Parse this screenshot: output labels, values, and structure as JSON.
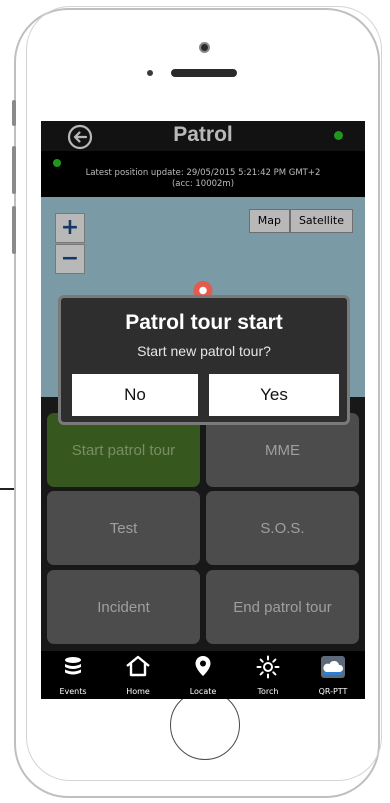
{
  "app": {
    "title": "Patrol"
  },
  "header": {
    "back_icon": "back-arrow-icon",
    "status_dot_color": "#2bd12b"
  },
  "position_status": {
    "line1": "Latest position update: 29/05/2015 5:21:42 PM GMT+2",
    "line2": "(acc: 10002m)"
  },
  "map": {
    "zoom_in": "+",
    "zoom_out": "−",
    "type_buttons": [
      "Map",
      "Satellite"
    ],
    "water_color": "#aad6e6",
    "marker_icon": "map-pin-icon"
  },
  "actions": {
    "tiles": [
      "Start patrol tour",
      "MME",
      "Test",
      "S.O.S.",
      "Incident",
      "End patrol tour"
    ],
    "highlight_color": "#4c7a2c"
  },
  "dialog": {
    "title": "Patrol tour start",
    "message": "Start new patrol tour?",
    "no_label": "No",
    "yes_label": "Yes"
  },
  "bottom_nav": [
    {
      "label": "Events",
      "icon": "database-icon"
    },
    {
      "label": "Home",
      "icon": "home-icon"
    },
    {
      "label": "Locate",
      "icon": "location-pin-icon"
    },
    {
      "label": "Torch",
      "icon": "sun-icon"
    },
    {
      "label": "QR-PTT",
      "icon": "cloud-icon"
    }
  ]
}
